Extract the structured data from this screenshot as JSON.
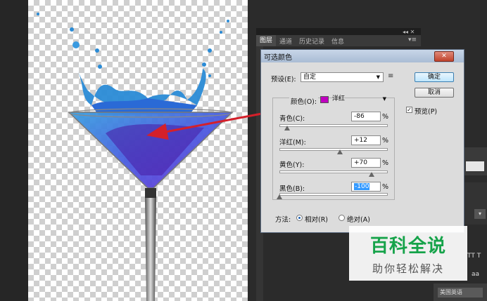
{
  "photoshop_panels": {
    "tabs": [
      "图层",
      "通道",
      "历史记录",
      "信息"
    ],
    "controls": "◂◂ ✕",
    "menu": "▾≡"
  },
  "dialog": {
    "title": "可选颜色",
    "close_label": "✕",
    "preset_label": "预设(E):",
    "preset_value": "自定",
    "preset_menu_icon": "preset-options-icon",
    "ok_label": "确定",
    "cancel_label": "取消",
    "preview_label": "预览(P)",
    "preview_checked": true,
    "colors_label": "颜色(O):",
    "colors_value": "洋红",
    "colors_swatch": "#c000c0",
    "sliders": [
      {
        "label": "青色(C):",
        "value": "-86",
        "unit": "%",
        "level": -86
      },
      {
        "label": "洋红(M):",
        "value": "+12",
        "unit": "%",
        "level": 12
      },
      {
        "label": "黄色(Y):",
        "value": "+70",
        "unit": "%",
        "level": 70
      },
      {
        "label": "黑色(B):",
        "value": "-100",
        "unit": "%",
        "level": -100
      }
    ],
    "method_label": "方法:",
    "method_relative": "相对(R)",
    "method_absolute": "绝对(A)",
    "method_selected": "relative"
  },
  "right_side": {
    "tt_text": "TT T",
    "aa_text": "aa",
    "lang_text": "美国英语",
    "dropdown_arrow": "▾"
  },
  "watermark": {
    "title": "百科全说",
    "subtitle": "助你轻松解决"
  },
  "colors": {
    "arrow": "#d4202a",
    "liquid_blue": "#2a8bd6",
    "liquid_purple": "#6a2fd6"
  }
}
